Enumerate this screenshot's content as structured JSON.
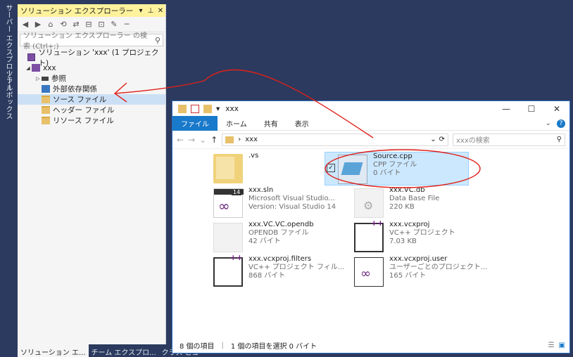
{
  "vertical_tabs": {
    "server_explorer": "サーバー エクスプローラー",
    "toolbox": "ツールボックス"
  },
  "solution_explorer": {
    "title": "ソリューション エクスプローラー",
    "title_buttons": [
      "▾",
      "⊥",
      "✕"
    ],
    "search_placeholder": "ソリューション エクスプローラー の検索 (Ctrl+;)",
    "tree": [
      {
        "label": "ソリューション 'xxx' (1 プロジェクト)",
        "icon": "solution-icon",
        "level": 0,
        "expander": ""
      },
      {
        "label": "xxx",
        "icon": "cpp-project-icon",
        "level": 1,
        "expander": "◢"
      },
      {
        "label": "参照",
        "icon": "references-icon",
        "level": 2,
        "expander": "▷"
      },
      {
        "label": "外部依存関係",
        "icon": "external-deps-icon",
        "level": 2,
        "expander": ""
      },
      {
        "label": "ソース ファイル",
        "icon": "folder-icon",
        "level": 2,
        "expander": "",
        "selected": true
      },
      {
        "label": "ヘッダー ファイル",
        "icon": "folder-icon",
        "level": 2,
        "expander": ""
      },
      {
        "label": "リソース ファイル",
        "icon": "folder-icon",
        "level": 2,
        "expander": ""
      }
    ],
    "bottom_tabs": [
      "ソリューション エ...",
      "チーム エクスプロ...",
      "クラス ビュー"
    ]
  },
  "file_explorer": {
    "title": "xxx",
    "window_buttons": [
      "—",
      "☐",
      "✕"
    ],
    "ribbon_tabs": [
      "ファイル",
      "ホーム",
      "共有",
      "表示"
    ],
    "address": "xxx",
    "search_placeholder": "xxxの検索",
    "items": [
      {
        "name": ".vs",
        "line2": "",
        "line3": "",
        "icon": "folder-icon"
      },
      {
        "name": "Source.cpp",
        "line2": "CPP ファイル",
        "line3": "0 バイト",
        "icon": "notepad-icon",
        "selected": true
      },
      {
        "name": "xxx.sln",
        "line2": "Microsoft Visual Studio...",
        "line3": "Version: Visual Studio 14",
        "icon": "vs-solution-icon",
        "badge": "14"
      },
      {
        "name": "xxx.VC.db",
        "line2": "Data Base File",
        "line3": "220 KB",
        "icon": "database-file-icon"
      },
      {
        "name": "xxx.VC.VC.opendb",
        "line2": "OPENDB ファイル",
        "line3": "42 バイト",
        "icon": "blank-file-icon"
      },
      {
        "name": "xxx.vcxproj",
        "line2": "VC++ プロジェクト",
        "line3": "7.03 KB",
        "icon": "vcxproj-icon"
      },
      {
        "name": "xxx.vcxproj.filters",
        "line2": "VC++ プロジェクト フィル...",
        "line3": "868 バイト",
        "icon": "vcxproj-filters-icon"
      },
      {
        "name": "xxx.vcxproj.user",
        "line2": "ユーザーごとのプロジェクト...",
        "line3": "165 バイト",
        "icon": "vcxproj-user-icon"
      }
    ],
    "status": {
      "count": "8 個の項目",
      "selection": "1 個の項目を選択  0 バイト"
    }
  },
  "colors": {
    "annotation_red": "#e0201a",
    "accent_blue": "#1979ca",
    "title_yellow": "#fff29d"
  }
}
